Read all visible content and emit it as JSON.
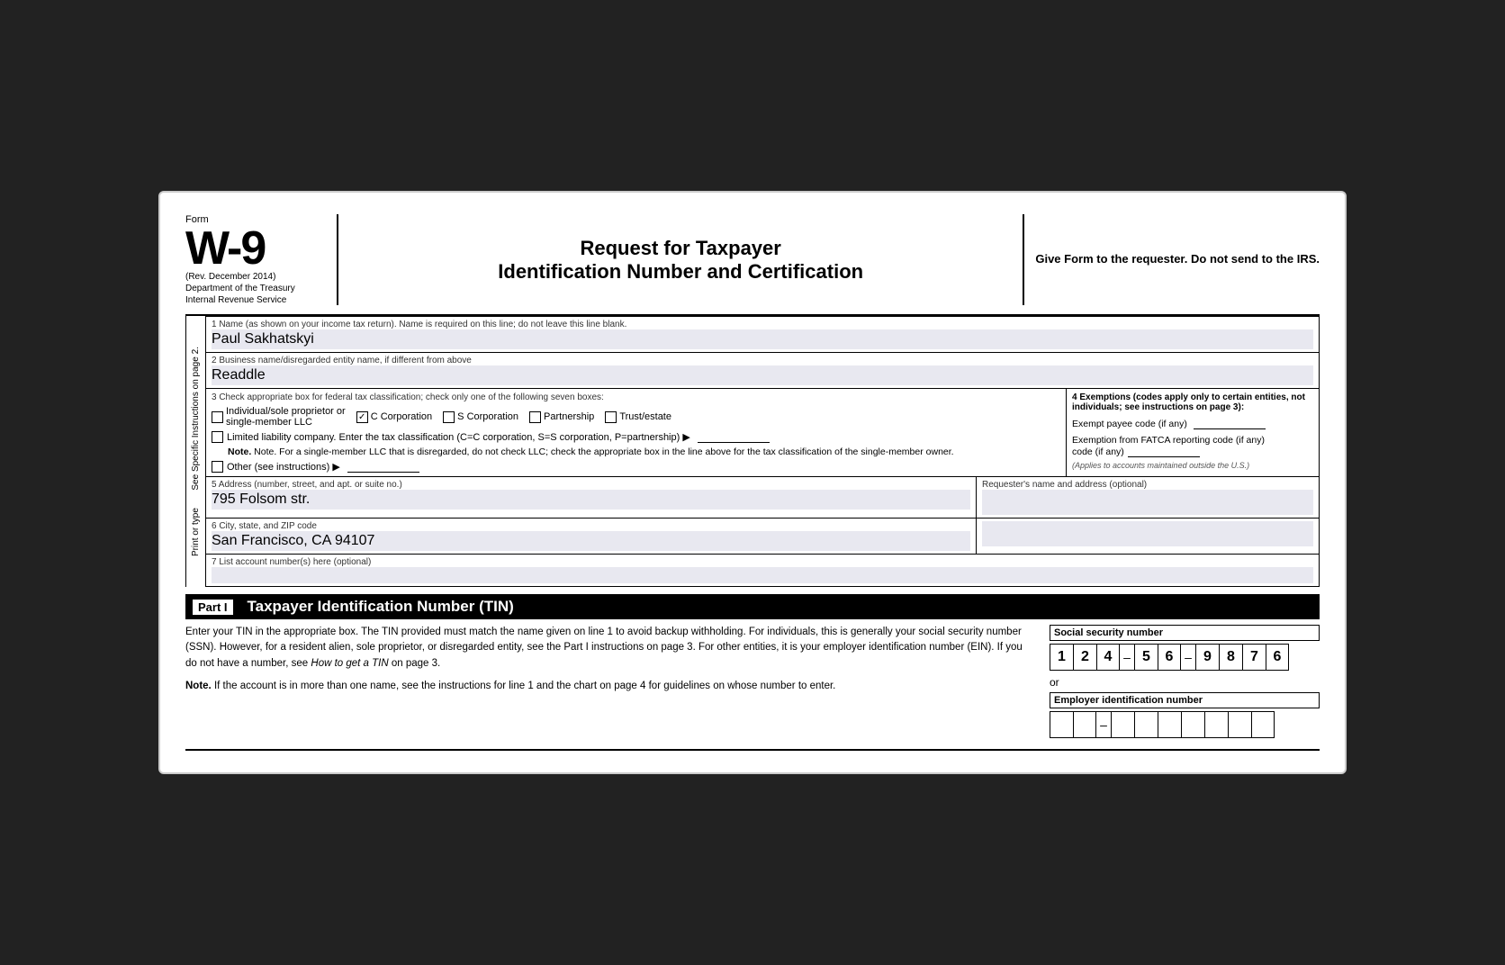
{
  "header": {
    "form_label": "Form",
    "form_number": "W-9",
    "rev_date": "(Rev. December 2014)",
    "dept_line1": "Department of the Treasury",
    "dept_line2": "Internal Revenue Service",
    "center_title_line1": "Request for Taxpayer",
    "center_title_line2": "Identification Number and Certification",
    "right_note": "Give Form to the requester. Do not send to the IRS."
  },
  "fields": {
    "field1_label": "1  Name (as shown on your income tax return). Name is required on this line; do not leave this line blank.",
    "field1_value": "Paul Sakhatskyi",
    "field2_label": "2  Business name/disregarded entity name, if different from above",
    "field2_value": "Readdle",
    "field3_label": "3  Check appropriate box for federal tax classification; check only one of the following seven boxes:",
    "field3_exemptions_label": "4  Exemptions (codes apply only to certain entities, not individuals; see instructions on page 3):",
    "exempt_payee_label": "Exempt payee code (if any)",
    "fatca_label": "Exemption from FATCA reporting code (if any)",
    "fatca_note": "(Applies to accounts maintained outside the U.S.)",
    "checkboxes": [
      {
        "label": "Individual/sole proprietor or single-member LLC",
        "checked": false
      },
      {
        "label": "C Corporation",
        "checked": true
      },
      {
        "label": "S Corporation",
        "checked": false
      },
      {
        "label": "Partnership",
        "checked": false
      },
      {
        "label": "Trust/estate",
        "checked": false
      }
    ],
    "llc_label": "Limited liability company. Enter the tax classification (C=C corporation, S=S corporation, P=partnership) ▶",
    "note_text": "Note. For a single-member LLC that is disregarded, do not check LLC; check the appropriate box in the line above for the tax classification of the single-member owner.",
    "other_label": "Other (see instructions) ▶",
    "field5_label": "5  Address (number, street, and apt. or suite no.)",
    "field5_value": "795 Folsom str.",
    "requesters_label": "Requester's name and address (optional)",
    "field6_label": "6  City, state, and ZIP code",
    "field6_value": "San Francisco, CA 94107",
    "field7_label": "7  List account number(s) here (optional)"
  },
  "sidebar": {
    "line1": "Print or type",
    "line2": "See Specific Instructions on page 2."
  },
  "part1": {
    "label": "Part I",
    "title": "Taxpayer Identification Number (TIN)",
    "body_text": "Enter your TIN in the appropriate box. The TIN provided must match the name given on line 1 to avoid backup withholding. For individuals, this is generally your social security number (SSN). However, for a resident alien, sole proprietor, or disregarded entity, see the Part I instructions on page 3. For other entities, it is your employer identification number (EIN). If you do not have a number, see How to get a TIN on page 3.",
    "note_text": "Note. If the account is in more than one name, see the instructions for line 1 and the chart on page 4 for guidelines on whose number to enter.",
    "ssn_label": "Social security number",
    "ssn_digits": [
      "1",
      "2",
      "4",
      "-",
      "5",
      "6",
      "-",
      "9",
      "8",
      "7",
      "6"
    ],
    "or_label": "or",
    "ein_label": "Employer identification number",
    "ein_digits": [
      "",
      "",
      "",
      "-",
      "",
      "",
      "",
      "",
      "",
      ""
    ]
  }
}
